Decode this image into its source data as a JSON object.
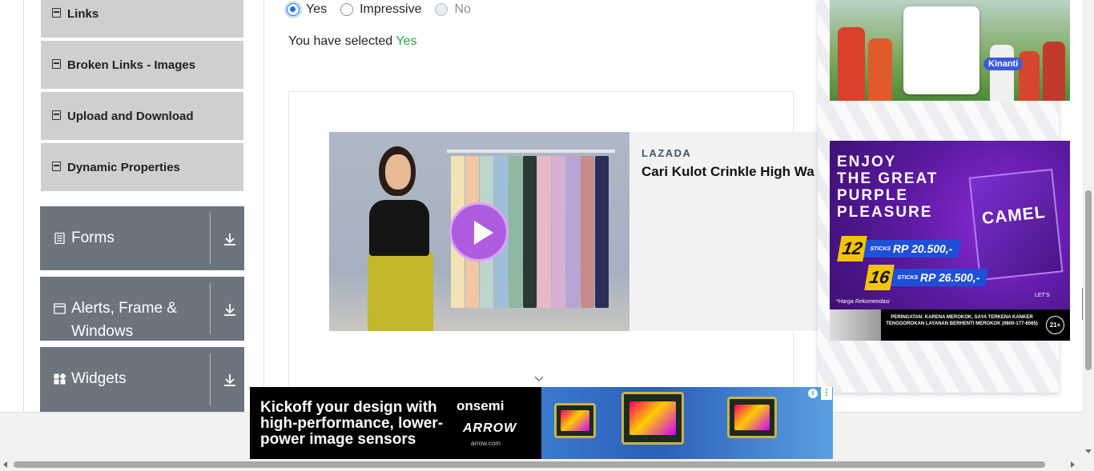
{
  "sidebar": {
    "elements_items": [
      {
        "label": "Links"
      },
      {
        "label": "Broken Links - Images"
      },
      {
        "label": "Upload and Download"
      },
      {
        "label": "Dynamic Properties"
      }
    ],
    "groups": [
      {
        "label": "Forms",
        "icon": "form-icon"
      },
      {
        "label_line1": "Alerts, Frame &",
        "label_line2": "Windows",
        "icon": "window-icon"
      },
      {
        "label": "Widgets",
        "icon": "widgets-icon"
      }
    ]
  },
  "radio_question": {
    "options": [
      {
        "label": "Yes",
        "checked": true,
        "disabled": false
      },
      {
        "label": "Impressive",
        "checked": false,
        "disabled": false
      },
      {
        "label": "No",
        "checked": false,
        "disabled": true
      }
    ],
    "result_prefix": "You have selected",
    "result_value": "Yes"
  },
  "video_ad": {
    "brand": "LAZADA",
    "title": "Cari Kulot Crinkle High Wa"
  },
  "right_ads": {
    "photo_tag": "Kinanti",
    "camel": {
      "headline_1": "ENJOY",
      "headline_2": "THE GREAT",
      "headline_3": "PURPLE",
      "headline_4": "PLEASURE",
      "brand": "CAMEL",
      "price_1_count": "12",
      "price_1_unit": "STICKS",
      "price_1": "RP 20.500,-",
      "price_2_count": "16",
      "price_2_unit": "STICKS",
      "price_2": "RP 26.500,-",
      "note": "*Harga Rekomendasi",
      "lets": "LET'S",
      "warning": "PERINGATAN: KARENA MEROKOK, SAYA TERKENA KANKER TENGGOROKAN LAYANAN BERHENTI MEROKOK (0800-177-6565)",
      "age": "21+"
    }
  },
  "bottom_ad": {
    "copy": "Kickoff your design with high-performance, lower-power image sensors",
    "brand": "onsemi",
    "partner": "ARROW",
    "url": "arrow.com",
    "info": "i",
    "more": "⋮"
  },
  "colors": {
    "menu_item_bg": "#cfcfcf",
    "group_bg": "#6c757d",
    "radio_accent": "#1a73e8",
    "selected_value": "#28a745"
  }
}
